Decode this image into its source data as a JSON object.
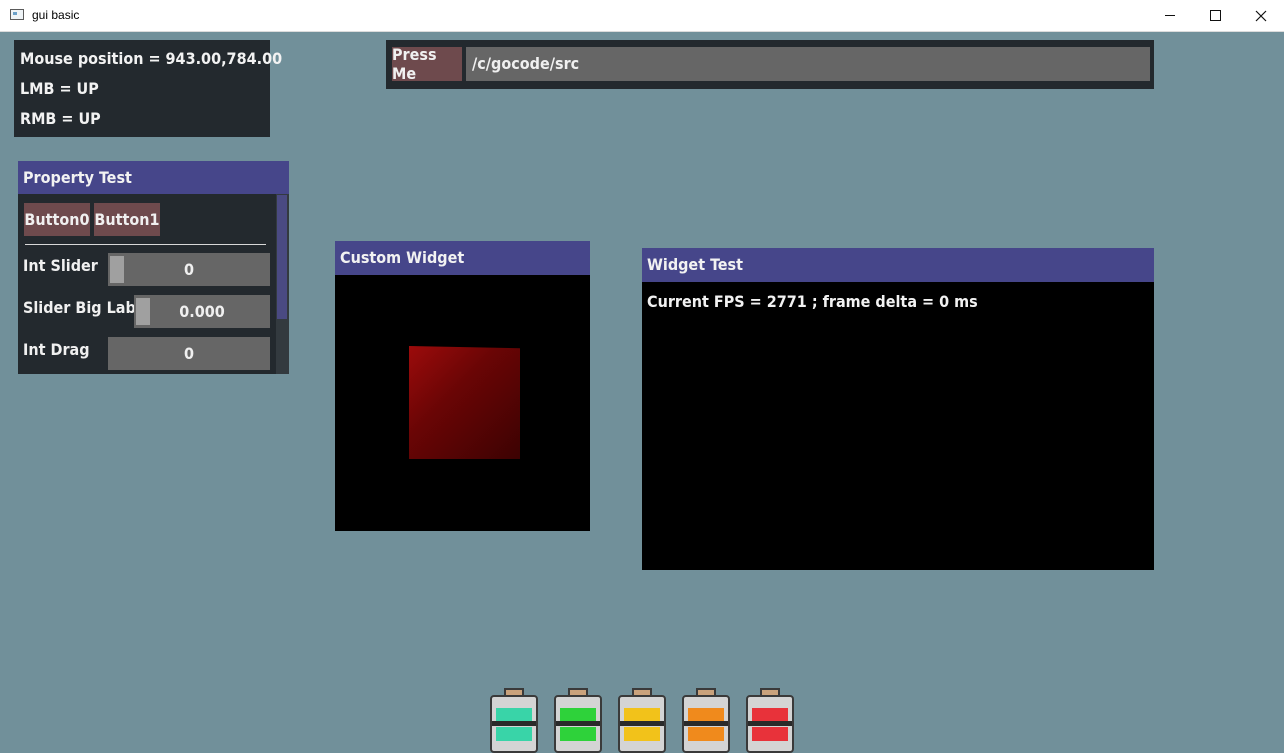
{
  "window": {
    "title": "gui basic"
  },
  "mouse_panel": {
    "position": "Mouse position = 943.00,784.00",
    "lmb": "LMB = UP",
    "rmb": "RMB = UP"
  },
  "toolbar": {
    "press_label": "Press Me",
    "path_value": "/c/gocode/src"
  },
  "property_test": {
    "title": "Property Test",
    "button0": "Button0",
    "button1": "Button1",
    "int_slider_label": "Int Slider",
    "int_slider_value": "0",
    "big_slider_label": "Slider Big Label",
    "big_slider_value": "0.000",
    "int_drag_label": "Int Drag",
    "int_drag_value": "0"
  },
  "custom_widget": {
    "title": "Custom Widget"
  },
  "widget_test": {
    "title": "Widget Test",
    "fps_text": "Current FPS = 2771 ; frame delta = 0 ms"
  },
  "batteries": [
    {
      "name": "battery-teal-icon",
      "color": "#39d4a8"
    },
    {
      "name": "battery-green-icon",
      "color": "#2ed23a"
    },
    {
      "name": "battery-yellow-icon",
      "color": "#f2c21a"
    },
    {
      "name": "battery-orange-icon",
      "color": "#f08a1c"
    },
    {
      "name": "battery-red-icon",
      "color": "#e8323a"
    }
  ]
}
